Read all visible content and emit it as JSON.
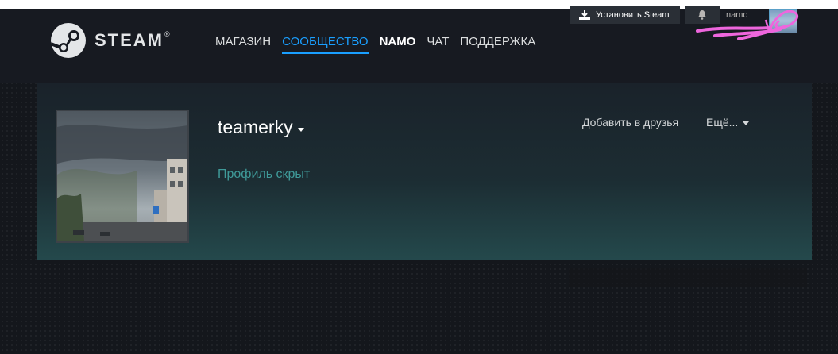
{
  "header": {
    "logo_text": "STEAM",
    "logo_trademark": "®",
    "nav": [
      {
        "label": "МАГАЗИН"
      },
      {
        "label": "СООБЩЕСТВО"
      },
      {
        "label": "NAMO"
      },
      {
        "label": "ЧАТ"
      },
      {
        "label": "ПОДДЕРЖКА"
      }
    ],
    "install_label": "Установить Steam",
    "account_name": "namo"
  },
  "profile": {
    "persona_name": "teamerky",
    "private_text": "Профиль скрыт",
    "add_friend_label": "Добавить в друзья",
    "more_label": "Ещё..."
  },
  "colors": {
    "header_bg": "#171a21",
    "nav_active": "#1a9fff",
    "private_text": "#3f9a99",
    "scribble": "#ee66dd"
  },
  "icons": [
    "steam-logo-icon",
    "download-icon",
    "bell-icon",
    "chevron-down-icon"
  ]
}
